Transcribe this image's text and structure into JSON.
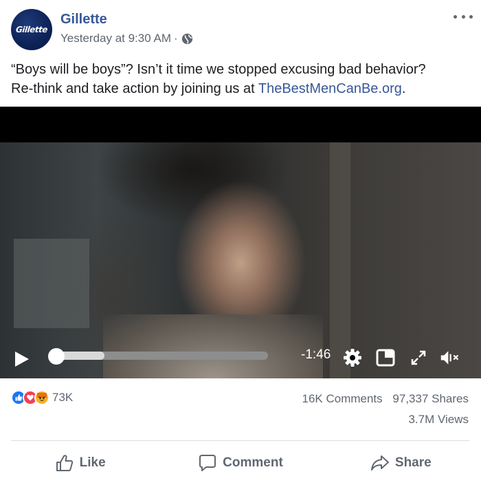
{
  "post": {
    "page_name": "Gillette",
    "avatar_text": "Gillette",
    "timestamp": "Yesterday at 9:30 AM",
    "separator": "·",
    "text_line1": "“Boys will be boys”? Isn’t it time we stopped excusing bad behavior?",
    "text_line2_prefix": "Re-think and take action by joining us at ",
    "link_text": "TheBestMenCanBe.org",
    "text_suffix": "."
  },
  "video": {
    "time_remaining": "-1:46",
    "progress_fraction": 0.25
  },
  "stats": {
    "reaction_count": "73K",
    "comments": "16K Comments",
    "shares": "97,337 Shares",
    "views": "3.7M Views"
  },
  "actions": {
    "like": "Like",
    "comment": "Comment",
    "share": "Share"
  },
  "icons": {
    "globe": "globe-icon",
    "more": "more-options-icon",
    "play": "play-icon",
    "settings": "gear-icon",
    "pip": "picture-in-picture-icon",
    "fullscreen": "expand-icon",
    "mute": "muted-speaker-icon"
  },
  "colors": {
    "brand_link": "#385898",
    "secondary_text": "#606770",
    "like_blue": "#1877f2",
    "love_red": "#f33e58",
    "angry_orange": "#f7b125"
  }
}
